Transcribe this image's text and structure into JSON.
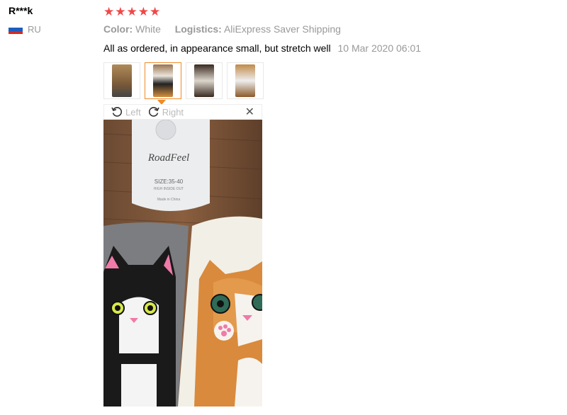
{
  "reviewer": {
    "name": "R***k",
    "country_code": "RU",
    "flag_colors": [
      "#ffffff",
      "#1c5dbf",
      "#d52b1e"
    ]
  },
  "rating": {
    "stars": 5,
    "max": 5,
    "color": "#f04848",
    "glyph": "★"
  },
  "attributes": {
    "color_label": "Color:",
    "color_value": "White",
    "logistics_label": "Logistics:",
    "logistics_value": "AliExpress Saver Shipping"
  },
  "review": {
    "text": "All as ordered, in appearance small, but stretch well",
    "date": "10 Mar 2020 06:01"
  },
  "thumbnails": [
    {
      "name": "photo-thumbnail-1",
      "active": false,
      "tone": "#8a6a44"
    },
    {
      "name": "photo-thumbnail-2",
      "active": true,
      "tone": "#6b4f34"
    },
    {
      "name": "photo-thumbnail-3",
      "active": false,
      "tone": "#3a2a20"
    },
    {
      "name": "photo-thumbnail-4",
      "active": false,
      "tone": "#9a6a3a"
    }
  ],
  "viewer": {
    "rotate_left_label": "Left",
    "rotate_right_label": "Right",
    "close_glyph": "✕",
    "accent": "#f08a24"
  },
  "photo": {
    "tag_brand": "RoadFeel",
    "tag_size": "SIZE:35-40",
    "tag_line1": "HIGH INSIDE OUT",
    "tag_made": "Made in China"
  }
}
